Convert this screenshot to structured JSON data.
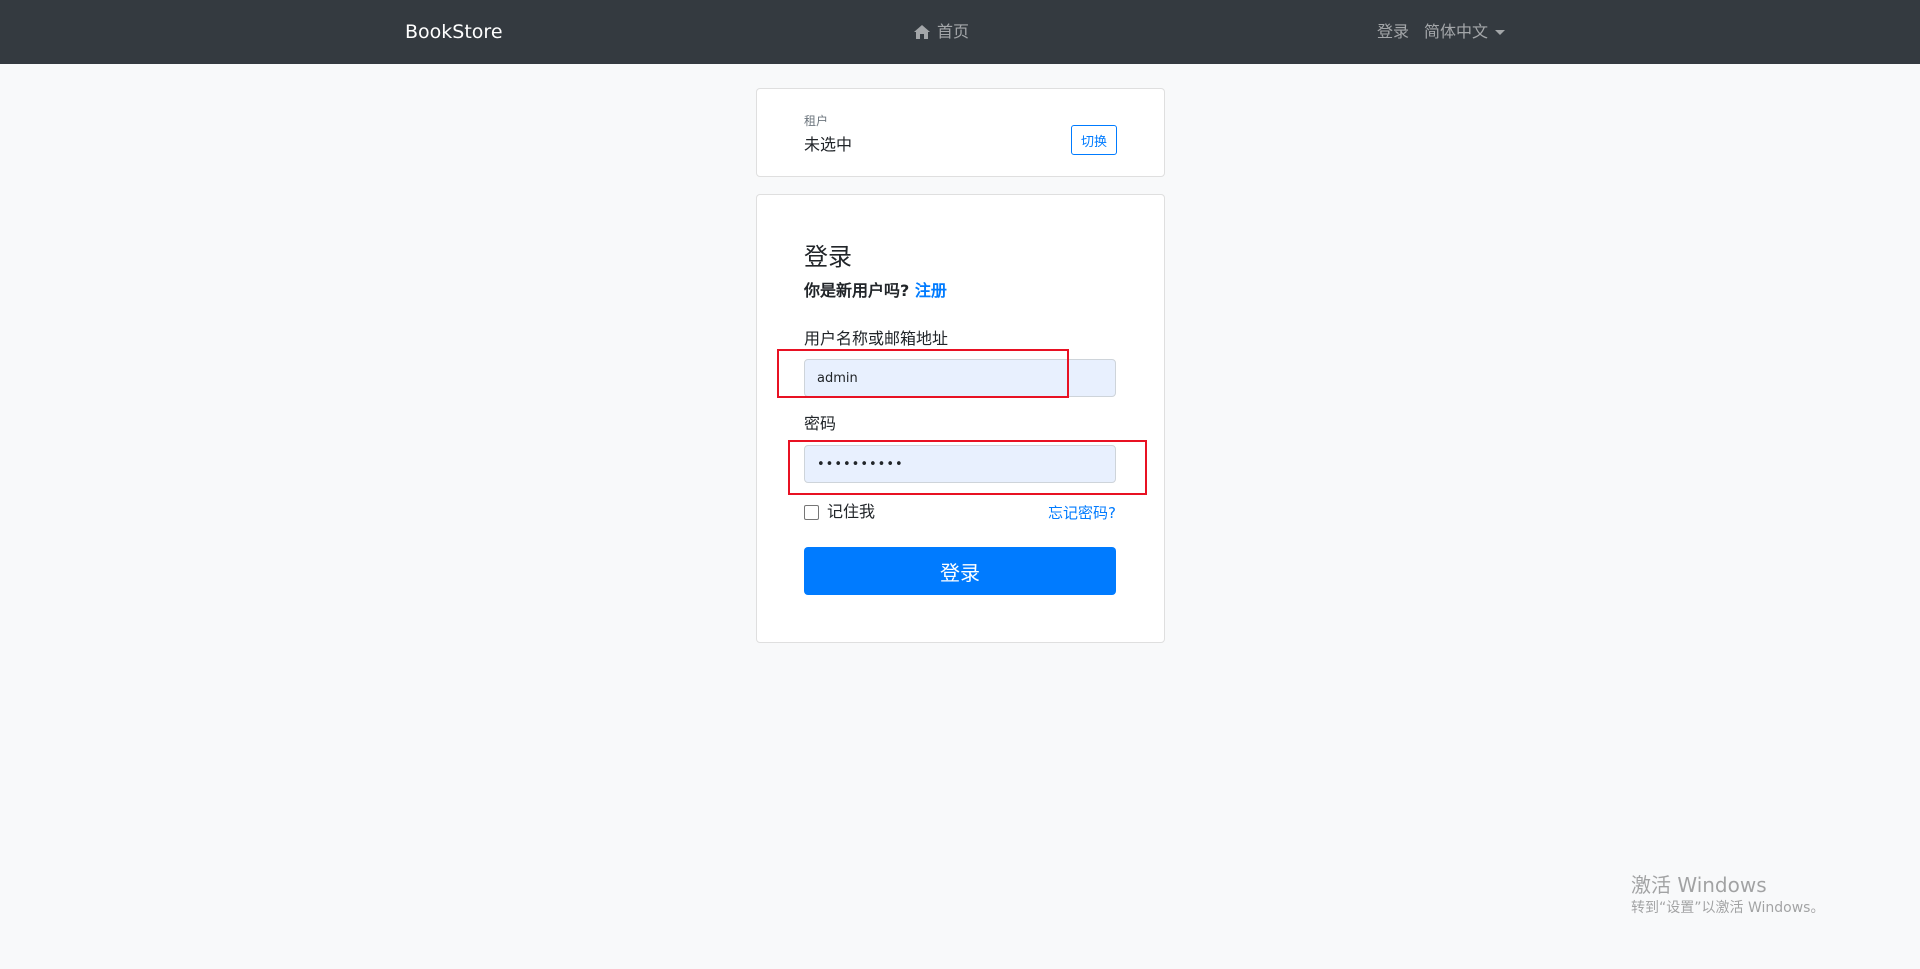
{
  "navbar": {
    "brand": "BookStore",
    "home_label": "首页",
    "login_link": "登录",
    "language": "简体中文",
    "home_icon": "home-icon",
    "language_icon": "caret-down-icon"
  },
  "tenant": {
    "label": "租户",
    "value": "未选中",
    "switch_label": "切换"
  },
  "login": {
    "title": "登录",
    "new_user_prompt": "你是新用户吗?",
    "register_link": "注册",
    "username_label": "用户名称或邮箱地址",
    "username_value": "admin",
    "password_label": "密码",
    "password_value": "1q2w3E*abc",
    "remember_label": "记住我",
    "forgot_link": "忘记密码?",
    "submit_label": "登录"
  },
  "watermark": {
    "title": "激活 Windows",
    "subtitle": "转到“设置”以激活 Windows。"
  },
  "colors": {
    "navbar_bg": "#343a40",
    "primary": "#007bff",
    "page_bg": "#f8f9fa",
    "input_autofill_bg": "#e8f0fe",
    "annotation_red": "#e81123"
  }
}
